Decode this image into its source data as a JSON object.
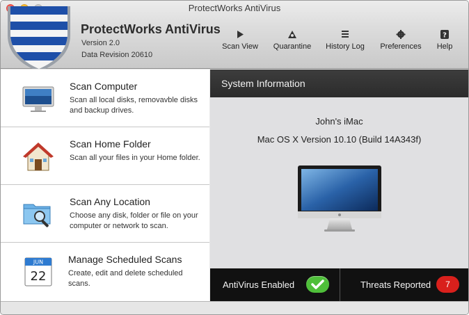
{
  "window": {
    "title": "ProtectWorks AntiVirus"
  },
  "app": {
    "name": "ProtectWorks AntiVirus",
    "version": "Version 2.0",
    "revision": "Data Revision 20610"
  },
  "toolbar": [
    {
      "label": "Scan View",
      "icon": "play-icon"
    },
    {
      "label": "Quarantine",
      "icon": "biohazard-icon"
    },
    {
      "label": "History Log",
      "icon": "list-icon"
    },
    {
      "label": "Preferences",
      "icon": "gear-icon"
    },
    {
      "label": "Help",
      "icon": "question-icon"
    }
  ],
  "tasks": [
    {
      "title": "Scan Computer",
      "description": "Scan all local disks, removavble disks and backup drives.",
      "icon": "computer-icon"
    },
    {
      "title": "Scan Home Folder",
      "description": "Scan all your files in your Home folder.",
      "icon": "home-icon"
    },
    {
      "title": "Scan Any Location",
      "description": "Choose any disk, folder or file on your computer or network to scan.",
      "icon": "folder-search-icon"
    },
    {
      "title": "Manage Scheduled Scans",
      "description": "Create, edit and delete scheduled scans.",
      "icon": "calendar-icon",
      "calendar_month": "JUN",
      "calendar_day": "22"
    }
  ],
  "system_info": {
    "header": "System Information",
    "computer_name": "John's iMac",
    "os_version": "Mac OS X Version 10.10 (Build 14A343f)"
  },
  "status": {
    "antivirus_label": "AntiVirus Enabled",
    "threats_label": "Threats Reported",
    "threats_count": "7"
  },
  "colors": {
    "enabled_green": "#4fbf3a",
    "threat_red": "#d9201c",
    "shield_blue": "#1e4fa8"
  }
}
